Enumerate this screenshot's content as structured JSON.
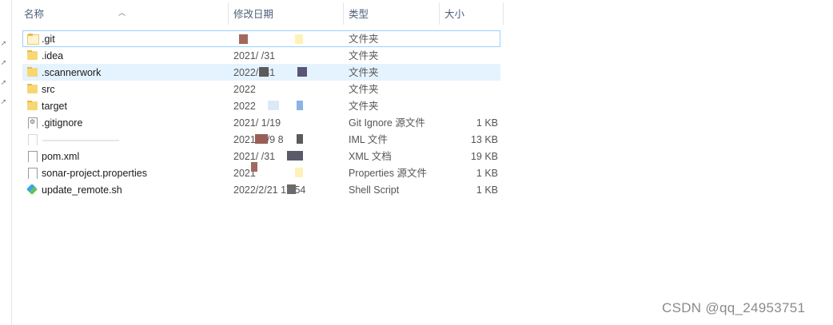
{
  "columns": {
    "name": "名称",
    "date": "修改日期",
    "type": "类型",
    "size": "大小"
  },
  "files": [
    {
      "name": ".git",
      "date": "",
      "type": "文件夹",
      "size": "",
      "icon": "folder-icon",
      "focused": true
    },
    {
      "name": ".idea",
      "date": "2021/ /31",
      "type": "文件夹",
      "size": "",
      "icon": "folder-icon"
    },
    {
      "name": ".scannerwork",
      "date": "2022/ /31",
      "type": "文件夹",
      "size": "",
      "icon": "folder-icon",
      "selected": true
    },
    {
      "name": "src",
      "date": "2022",
      "type": "文件夹",
      "size": "",
      "icon": "folder-icon"
    },
    {
      "name": "target",
      "date": "2022",
      "type": "文件夹",
      "size": "",
      "icon": "folder-icon"
    },
    {
      "name": ".gitignore",
      "date": "2021/ 1/19",
      "type": "Git Ignore 源文件",
      "size": "1 KB",
      "icon": "gitignore-file-icon"
    },
    {
      "name": "",
      "date": "2021/ 1/9 8",
      "type": "IML 文件",
      "size": "13 KB",
      "icon": "iml-file-icon"
    },
    {
      "name": "pom.xml",
      "date": "2021/ /31",
      "type": "XML 文档",
      "size": "19 KB",
      "icon": "xml-file-icon"
    },
    {
      "name": "sonar-project.properties",
      "date": "2021",
      "type": "Properties 源文件",
      "size": "1 KB",
      "icon": "properties-file-icon"
    },
    {
      "name": "update_remote.sh",
      "date": "2022/2/21 17:54",
      "type": "Shell Script",
      "size": "1 KB",
      "icon": "git-bash-icon"
    }
  ],
  "watermark": "CSDN @qq_24953751"
}
